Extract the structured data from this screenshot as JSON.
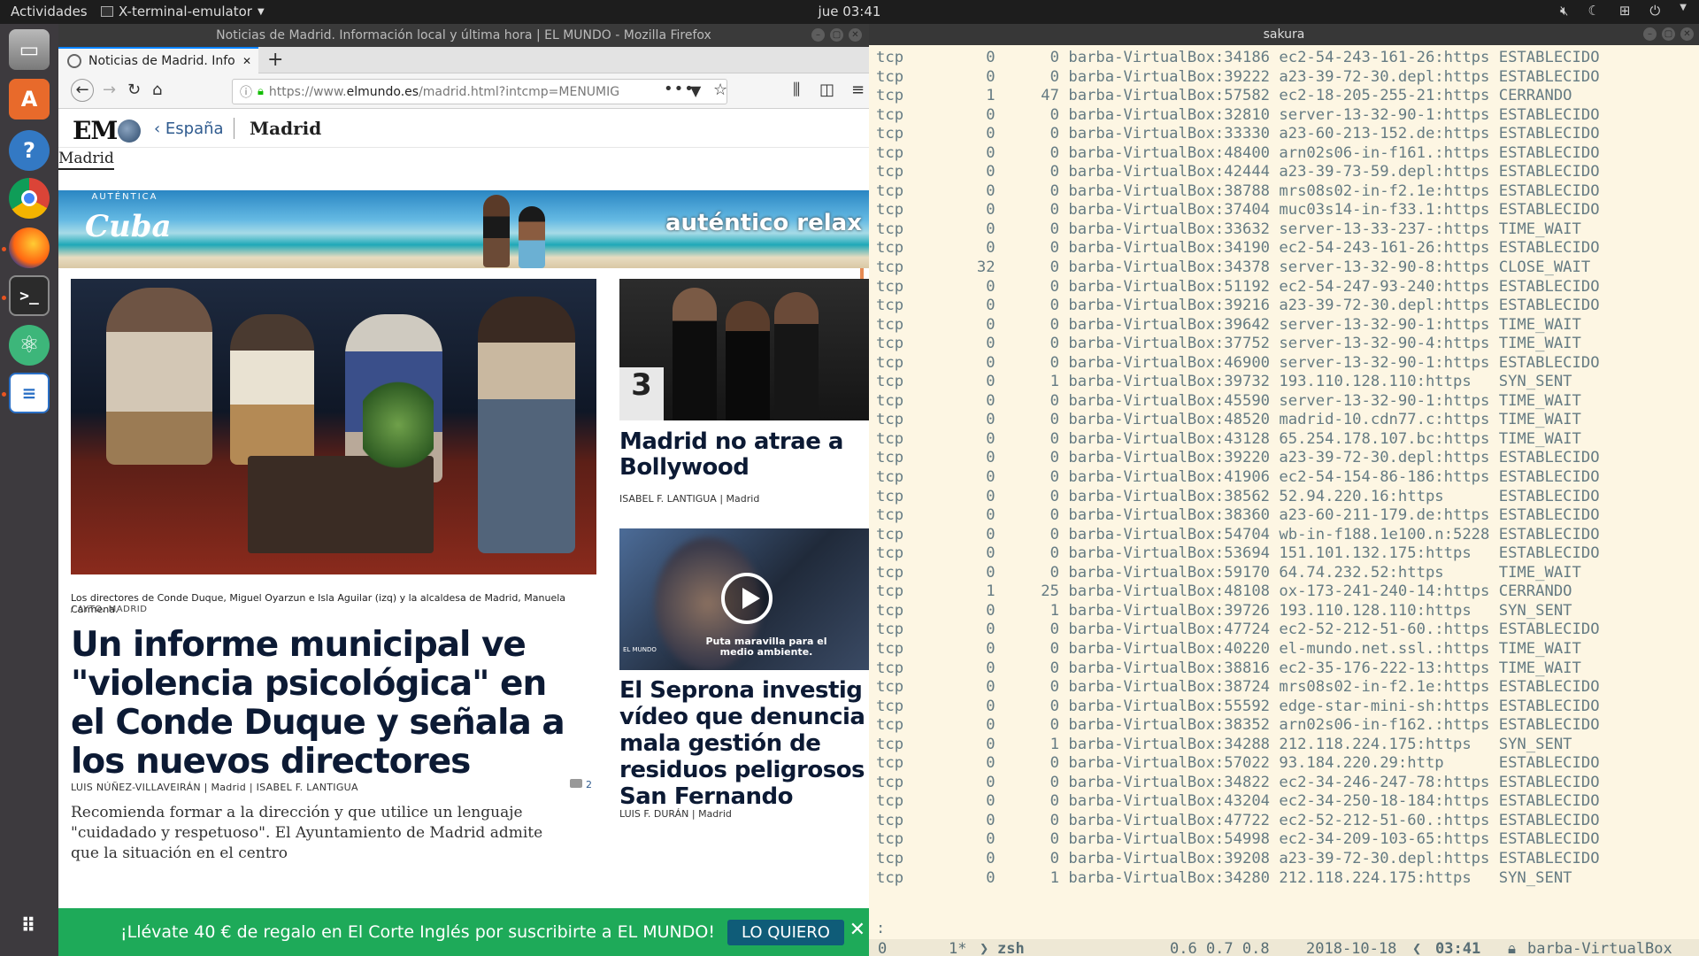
{
  "topbar": {
    "activities": "Actividades",
    "app_name": "X-terminal-emulator",
    "clock": "jue 03:41",
    "tray": [
      "sound-icon",
      "night-icon",
      "network-icon",
      "power-icon"
    ]
  },
  "dock": [
    "files-icon",
    "software-center-icon",
    "help-icon",
    "chrome-icon",
    "firefox-icon",
    "terminal-icon",
    "atom-icon",
    "writer-icon",
    "apps-grid-icon"
  ],
  "firefox": {
    "window_title": "Noticias de Madrid. Información local y última hora | EL MUNDO - Mozilla Firefox",
    "tab_title": "Noticias de Madrid. Info",
    "url_prefix": "https://www.",
    "url_domain": "elmundo.es",
    "url_path": "/madrid.html?intcmp=MENUMIG",
    "site": {
      "logo": "EM",
      "breadcrumb": "‹ España",
      "section": "Madrid",
      "section_nav": "Madrid",
      "banner_brand": "Cuba",
      "banner_brand_top": "AUTÉNTICA",
      "banner_slogan": "auténtico relax",
      "main_caption": "Los directores de Conde Duque, Miguel Oyarzun e Isla Aguilar (izq) y la alcaldesa de Madrid, Manuela Carmena.",
      "main_credit": "/ AYTO. MADRID",
      "main_headline": "Un informe municipal ve \"violencia psicológica\" en el Conde Duque y señala a los nuevos directores",
      "main_byline": "LUIS NÚÑEZ-VILLAVEIRÁN  | Madrid  | ISABEL F. LANTIGUA",
      "main_comments": "2",
      "main_lead": "Recomienda formar a la dirección y que utilice un lenguaje \"cuidadado y respetuoso\". El Ayuntamiento de Madrid admite que la situación en el centro",
      "side1_title": "Madrid no atrae a Bollywood",
      "side1_byline": "ISABEL F. LANTIGUA  | Madrid",
      "side2_title": "El Seprona investiga vídeo que denuncia mala gestión de residuos peligrosos San Fernando",
      "side2_title_lines": [
        "El Seprona investig",
        "vídeo que denuncia",
        "mala gestión de",
        "residuos peligrosos",
        "San Fernando"
      ],
      "side2_subtitle": "Puta maravilla para el medio ambiente.",
      "side2_byline": "LUIS F. DURÁN  | Madrid",
      "promo_text": "¡Llévate 40 € de regalo en El Corte Inglés por suscribirte a EL MUNDO!",
      "promo_button": "LO QUIERO"
    }
  },
  "terminal": {
    "title": "sakura",
    "rows": [
      [
        "tcp",
        "0",
        "0",
        "barba-VirtualBox:34186",
        "ec2-54-243-161-26:https",
        "ESTABLECIDO"
      ],
      [
        "tcp",
        "0",
        "0",
        "barba-VirtualBox:39222",
        "a23-39-72-30.depl:https",
        "ESTABLECIDO"
      ],
      [
        "tcp",
        "1",
        "47",
        "barba-VirtualBox:57582",
        "ec2-18-205-255-21:https",
        "CERRANDO"
      ],
      [
        "tcp",
        "0",
        "0",
        "barba-VirtualBox:32810",
        "server-13-32-90-1:https",
        "ESTABLECIDO"
      ],
      [
        "tcp",
        "0",
        "0",
        "barba-VirtualBox:33330",
        "a23-60-213-152.de:https",
        "ESTABLECIDO"
      ],
      [
        "tcp",
        "0",
        "0",
        "barba-VirtualBox:48400",
        "arn02s06-in-f161.:https",
        "ESTABLECIDO"
      ],
      [
        "tcp",
        "0",
        "0",
        "barba-VirtualBox:42444",
        "a23-39-73-59.depl:https",
        "ESTABLECIDO"
      ],
      [
        "tcp",
        "0",
        "0",
        "barba-VirtualBox:38788",
        "mrs08s02-in-f2.1e:https",
        "ESTABLECIDO"
      ],
      [
        "tcp",
        "0",
        "0",
        "barba-VirtualBox:37404",
        "muc03s14-in-f33.1:https",
        "ESTABLECIDO"
      ],
      [
        "tcp",
        "0",
        "0",
        "barba-VirtualBox:33632",
        "server-13-33-237-:https",
        "TIME_WAIT"
      ],
      [
        "tcp",
        "0",
        "0",
        "barba-VirtualBox:34190",
        "ec2-54-243-161-26:https",
        "ESTABLECIDO"
      ],
      [
        "tcp",
        "32",
        "0",
        "barba-VirtualBox:34378",
        "server-13-32-90-8:https",
        "CLOSE_WAIT"
      ],
      [
        "tcp",
        "0",
        "0",
        "barba-VirtualBox:51192",
        "ec2-54-247-93-240:https",
        "ESTABLECIDO"
      ],
      [
        "tcp",
        "0",
        "0",
        "barba-VirtualBox:39216",
        "a23-39-72-30.depl:https",
        "ESTABLECIDO"
      ],
      [
        "tcp",
        "0",
        "0",
        "barba-VirtualBox:39642",
        "server-13-32-90-1:https",
        "TIME_WAIT"
      ],
      [
        "tcp",
        "0",
        "0",
        "barba-VirtualBox:37752",
        "server-13-32-90-4:https",
        "TIME_WAIT"
      ],
      [
        "tcp",
        "0",
        "0",
        "barba-VirtualBox:46900",
        "server-13-32-90-1:https",
        "ESTABLECIDO"
      ],
      [
        "tcp",
        "0",
        "1",
        "barba-VirtualBox:39732",
        "193.110.128.110:https",
        "SYN_SENT"
      ],
      [
        "tcp",
        "0",
        "0",
        "barba-VirtualBox:45590",
        "server-13-32-90-1:https",
        "TIME_WAIT"
      ],
      [
        "tcp",
        "0",
        "0",
        "barba-VirtualBox:48520",
        "madrid-10.cdn77.c:https",
        "TIME_WAIT"
      ],
      [
        "tcp",
        "0",
        "0",
        "barba-VirtualBox:43128",
        "65.254.178.107.bc:https",
        "TIME_WAIT"
      ],
      [
        "tcp",
        "0",
        "0",
        "barba-VirtualBox:39220",
        "a23-39-72-30.depl:https",
        "ESTABLECIDO"
      ],
      [
        "tcp",
        "0",
        "0",
        "barba-VirtualBox:41906",
        "ec2-54-154-86-186:https",
        "ESTABLECIDO"
      ],
      [
        "tcp",
        "0",
        "0",
        "barba-VirtualBox:38562",
        "52.94.220.16:https",
        "ESTABLECIDO"
      ],
      [
        "tcp",
        "0",
        "0",
        "barba-VirtualBox:38360",
        "a23-60-211-179.de:https",
        "ESTABLECIDO"
      ],
      [
        "tcp",
        "0",
        "0",
        "barba-VirtualBox:54704",
        "wb-in-f188.1e100.n:5228",
        "ESTABLECIDO"
      ],
      [
        "tcp",
        "0",
        "0",
        "barba-VirtualBox:53694",
        "151.101.132.175:https",
        "ESTABLECIDO"
      ],
      [
        "tcp",
        "0",
        "0",
        "barba-VirtualBox:59170",
        "64.74.232.52:https",
        "TIME_WAIT"
      ],
      [
        "tcp",
        "1",
        "25",
        "barba-VirtualBox:48108",
        "ox-173-241-240-14:https",
        "CERRANDO"
      ],
      [
        "tcp",
        "0",
        "1",
        "barba-VirtualBox:39726",
        "193.110.128.110:https",
        "SYN_SENT"
      ],
      [
        "tcp",
        "0",
        "0",
        "barba-VirtualBox:47724",
        "ec2-52-212-51-60.:https",
        "ESTABLECIDO"
      ],
      [
        "tcp",
        "0",
        "0",
        "barba-VirtualBox:40220",
        "el-mundo.net.ssl.:https",
        "TIME_WAIT"
      ],
      [
        "tcp",
        "0",
        "0",
        "barba-VirtualBox:38816",
        "ec2-35-176-222-13:https",
        "TIME_WAIT"
      ],
      [
        "tcp",
        "0",
        "0",
        "barba-VirtualBox:38724",
        "mrs08s02-in-f2.1e:https",
        "ESTABLECIDO"
      ],
      [
        "tcp",
        "0",
        "0",
        "barba-VirtualBox:55592",
        "edge-star-mini-sh:https",
        "ESTABLECIDO"
      ],
      [
        "tcp",
        "0",
        "0",
        "barba-VirtualBox:38352",
        "arn02s06-in-f162.:https",
        "ESTABLECIDO"
      ],
      [
        "tcp",
        "0",
        "1",
        "barba-VirtualBox:34288",
        "212.118.224.175:https",
        "SYN_SENT"
      ],
      [
        "tcp",
        "0",
        "0",
        "barba-VirtualBox:57022",
        "93.184.220.29:http",
        "ESTABLECIDO"
      ],
      [
        "tcp",
        "0",
        "0",
        "barba-VirtualBox:34822",
        "ec2-34-246-247-78:https",
        "ESTABLECIDO"
      ],
      [
        "tcp",
        "0",
        "0",
        "barba-VirtualBox:43204",
        "ec2-34-250-18-184:https",
        "ESTABLECIDO"
      ],
      [
        "tcp",
        "0",
        "0",
        "barba-VirtualBox:47722",
        "ec2-52-212-51-60.:https",
        "ESTABLECIDO"
      ],
      [
        "tcp",
        "0",
        "0",
        "barba-VirtualBox:54998",
        "ec2-34-209-103-65:https",
        "ESTABLECIDO"
      ],
      [
        "tcp",
        "0",
        "0",
        "barba-VirtualBox:39208",
        "a23-39-72-30.depl:https",
        "ESTABLECIDO"
      ],
      [
        "tcp",
        "0",
        "1",
        "barba-VirtualBox:34280",
        "212.118.224.175:https",
        "SYN_SENT"
      ]
    ],
    "prompt": ":",
    "status": {
      "window_index": "0",
      "pane": "1*",
      "shell": "zsh",
      "load": "0.6 0.7 0.8",
      "date": "2018-10-18",
      "time": "03:41",
      "host": "barba-VirtualBox"
    }
  }
}
